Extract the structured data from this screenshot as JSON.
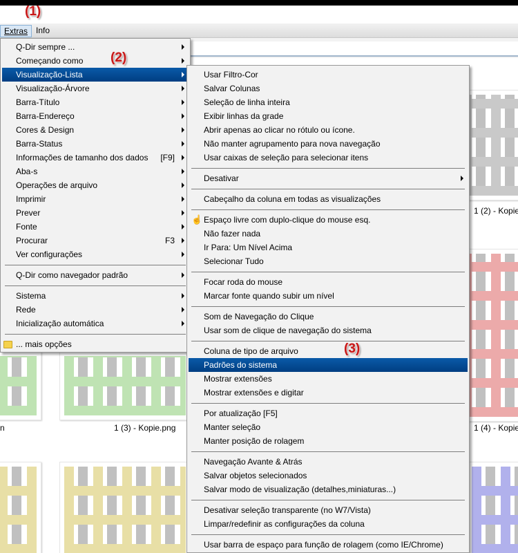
{
  "callouts": {
    "c1": "(1)",
    "c2": "(2)",
    "c3": "(3)"
  },
  "menubar": {
    "extras": "Extras",
    "info": "Info"
  },
  "files": {
    "label_a": "1 (2) - Kopie",
    "label_b": "1 (3) - Kopie.png",
    "label_c": "1 (4) - Kopie",
    "label_d": "n"
  },
  "extras_menu": {
    "items": [
      {
        "label": "Q-Dir sempre ...",
        "has_submenu": true
      },
      {
        "label": "Começando como",
        "has_submenu": true
      },
      {
        "label": "Visualização-Lista",
        "has_submenu": true,
        "highlighted": true
      },
      {
        "label": "Visualização-Árvore",
        "has_submenu": true
      },
      {
        "label": "Barra-Título",
        "has_submenu": true
      },
      {
        "label": "Barra-Endereço",
        "has_submenu": true
      },
      {
        "label": "Cores & Design",
        "has_submenu": true
      },
      {
        "label": "Barra-Status",
        "has_submenu": true
      },
      {
        "label": "Informações de tamanho dos dados",
        "shortcut": "[F9]",
        "has_submenu": true
      },
      {
        "label": "Aba-s",
        "has_submenu": true
      },
      {
        "label": "Operações de arquivo",
        "has_submenu": true
      },
      {
        "label": "Imprimir",
        "has_submenu": true
      },
      {
        "label": "Prever",
        "has_submenu": true
      },
      {
        "label": "Fonte",
        "has_submenu": true
      },
      {
        "label": "Procurar",
        "shortcut": "F3",
        "has_submenu": true
      },
      {
        "label": "Ver configurações",
        "has_submenu": true
      },
      {
        "label": "Q-Dir como navegador padrão",
        "has_submenu": true
      },
      {
        "label": "Sistema",
        "has_submenu": true
      },
      {
        "label": "Rede",
        "has_submenu": true
      },
      {
        "label": "Inicialização automática",
        "has_submenu": true
      },
      {
        "label": "... mais opções",
        "icon": "folder-icon"
      }
    ]
  },
  "list_menu": {
    "items": [
      {
        "label": "Usar Filtro-Cor"
      },
      {
        "label": "Salvar Colunas"
      },
      {
        "label": "Seleção de linha inteira"
      },
      {
        "label": "Exibir linhas da grade"
      },
      {
        "label": "Abrir apenas ao clicar no rótulo ou ícone."
      },
      {
        "label": "Não manter agrupamento para nova navegação"
      },
      {
        "label": "Usar caixas de seleção para selecionar itens"
      },
      {
        "label": "Desativar",
        "has_submenu": true
      },
      {
        "label": "Cabeçalho da coluna em todas as visualizações"
      },
      {
        "label": "Espaço livre com duplo-clique do mouse esq.",
        "icon": "hand-pointer-icon"
      },
      {
        "label": "Não fazer nada"
      },
      {
        "label": "Ir Para: Um Nível Acima"
      },
      {
        "label": "Selecionar Tudo"
      },
      {
        "label": "Focar roda do mouse"
      },
      {
        "label": "Marcar fonte quando subir um nível"
      },
      {
        "label": "Som de Navegação do Clique"
      },
      {
        "label": "Usar som de clique de navegação do sistema"
      },
      {
        "label": "Coluna de tipo de arquivo"
      },
      {
        "label": "Padrões do sistema",
        "highlighted": true
      },
      {
        "label": "Mostrar extensões"
      },
      {
        "label": "Mostrar extensões e digitar"
      },
      {
        "label": "Por atualização [F5]"
      },
      {
        "label": "Manter seleção"
      },
      {
        "label": "Manter posição de rolagem"
      },
      {
        "label": "Navegação Avante & Atrás"
      },
      {
        "label": "Salvar objetos selecionados"
      },
      {
        "label": "Salvar modo de visualização (detalhes,miniaturas...)"
      },
      {
        "label": "Desativar seleção transparente (no W7/Vista)"
      },
      {
        "label": "Limpar/redefinir as configurações da coluna"
      },
      {
        "label": "Usar barra de espaço para função de rolagem (como IE/Chrome)"
      }
    ]
  },
  "colors": {
    "highlight": "#0a4f9e",
    "callout": "#c81818",
    "thumb_gray": "#c9c9c9",
    "thumb_green": "#bfe3b3",
    "thumb_red": "#ecaaaa",
    "thumb_yellow": "#e8dfa6",
    "thumb_blue": "#b1b1ec"
  }
}
